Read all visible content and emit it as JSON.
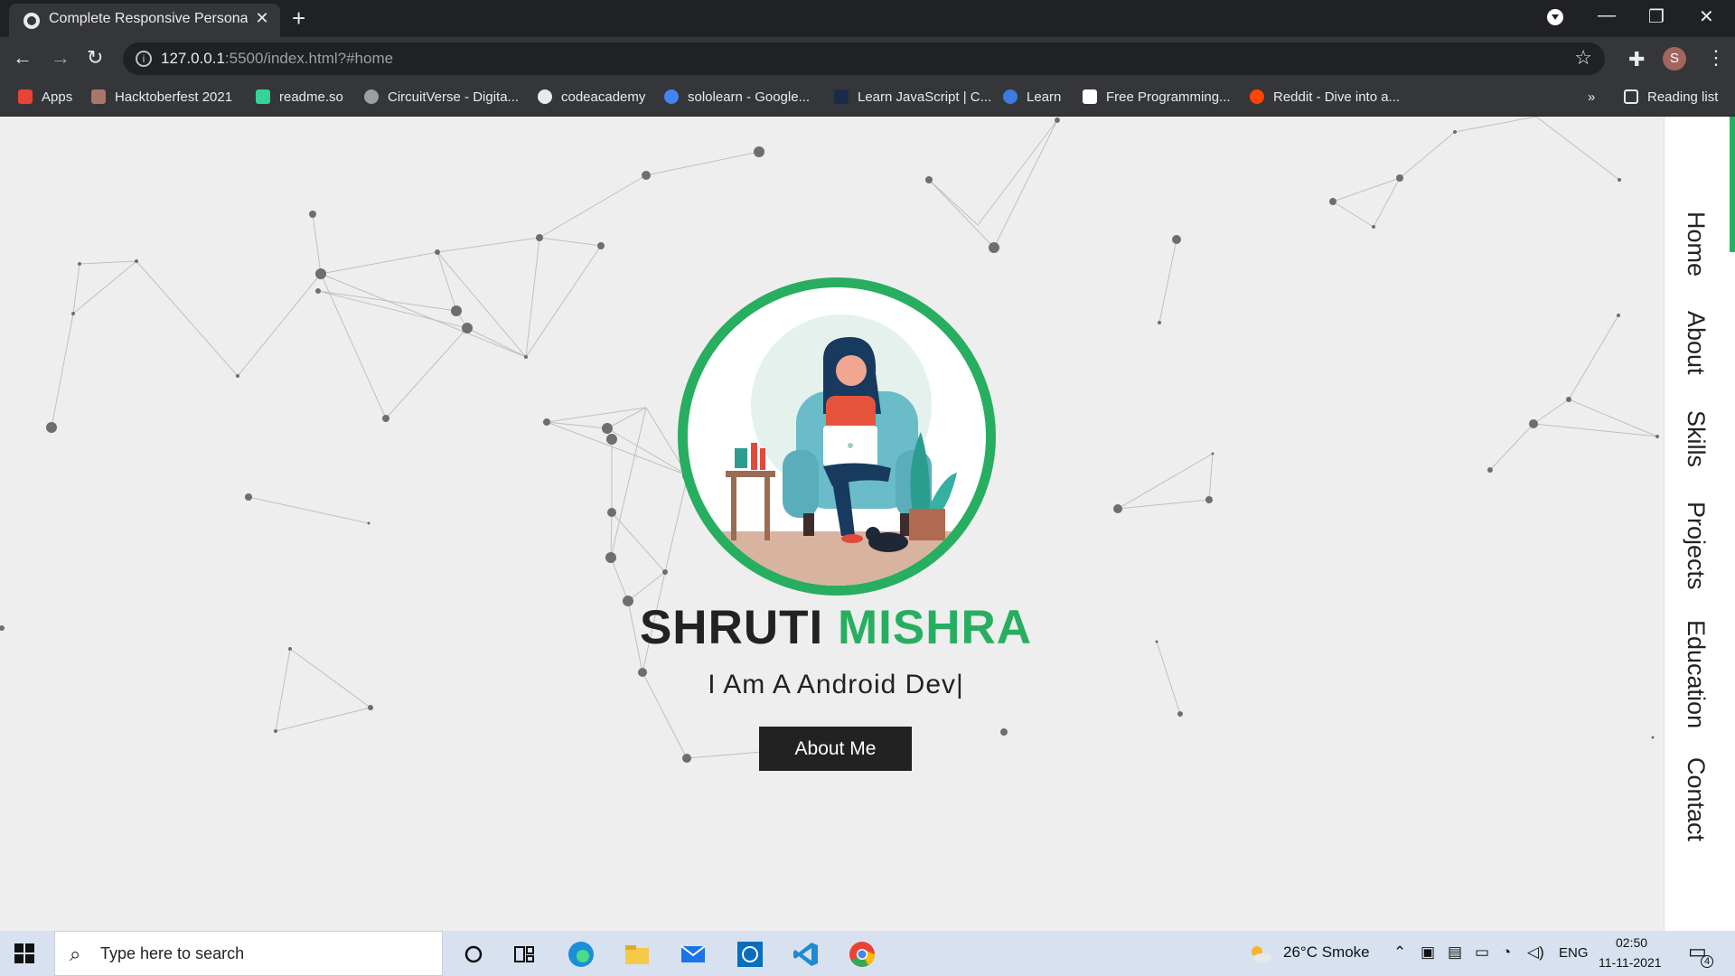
{
  "browser": {
    "tab_title": "Complete Responsive Personal Po",
    "url_host": "127.0.0.1",
    "url_rest": ":5500/index.html?#home",
    "avatar_letter": "S",
    "bookmarks": [
      {
        "label": "Apps",
        "color": "#f28b82"
      },
      {
        "label": "Hacktoberfest 2021",
        "color": "#a8776a"
      },
      {
        "label": "readme.so",
        "color": "#34d399"
      },
      {
        "label": "CircuitVerse - Digita...",
        "color": "#9aa0a6"
      },
      {
        "label": "codeacademy",
        "color": "#e8eaed"
      },
      {
        "label": "sololearn - Google...",
        "color": "#4285f4"
      },
      {
        "label": "Learn JavaScript | C...",
        "color": "#1a73e8"
      },
      {
        "label": "Learn",
        "color": "#3c7be0"
      },
      {
        "label": "Free Programming...",
        "color": "#ffffff"
      },
      {
        "label": "Reddit - Dive into a...",
        "color": "#ff4500"
      }
    ],
    "reading_list": "Reading list",
    "overflow": "»"
  },
  "sidebar": {
    "items": [
      "Home",
      "About",
      "Skills",
      "Projects",
      "Education",
      "Contact"
    ],
    "accent_color": "#27ae60"
  },
  "hero": {
    "first_name": "SHRUTI",
    "last_name": "MISHRA",
    "role_text": "I Am A Android Dev|",
    "button_label": "About Me",
    "accent_color": "#27ae60"
  },
  "taskbar": {
    "search_placeholder": "Type here to search",
    "weather": "26°C  Smoke",
    "language": "ENG",
    "time": "02:50",
    "date": "11-11-2021",
    "notifications": "4"
  }
}
